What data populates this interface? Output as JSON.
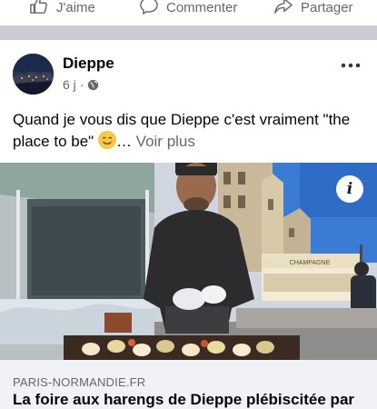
{
  "actions": {
    "like_label": "J'aime",
    "comment_label": "Commenter",
    "share_label": "Partager"
  },
  "post": {
    "page_name": "Dieppe",
    "time": "6 j",
    "separator": "·",
    "text_main": "Quand je vous dis que Dieppe c'est vraiment \"the place to be\" ",
    "ellipsis": "…",
    "see_more": "Voir plus",
    "emoji": "smiling-face-emoji"
  },
  "image": {
    "stall_sign": "CHAMPAGNE",
    "info_label": "i"
  },
  "link_preview": {
    "domain": "PARIS-NORMANDIE.FR",
    "title": "La foire aux harengs de Dieppe plébiscitée par"
  },
  "colors": {
    "separator": "#c9ccd1",
    "secondary_text": "#65676b",
    "preview_bg": "#f0f2f5",
    "sky": "#3a7bd5"
  }
}
